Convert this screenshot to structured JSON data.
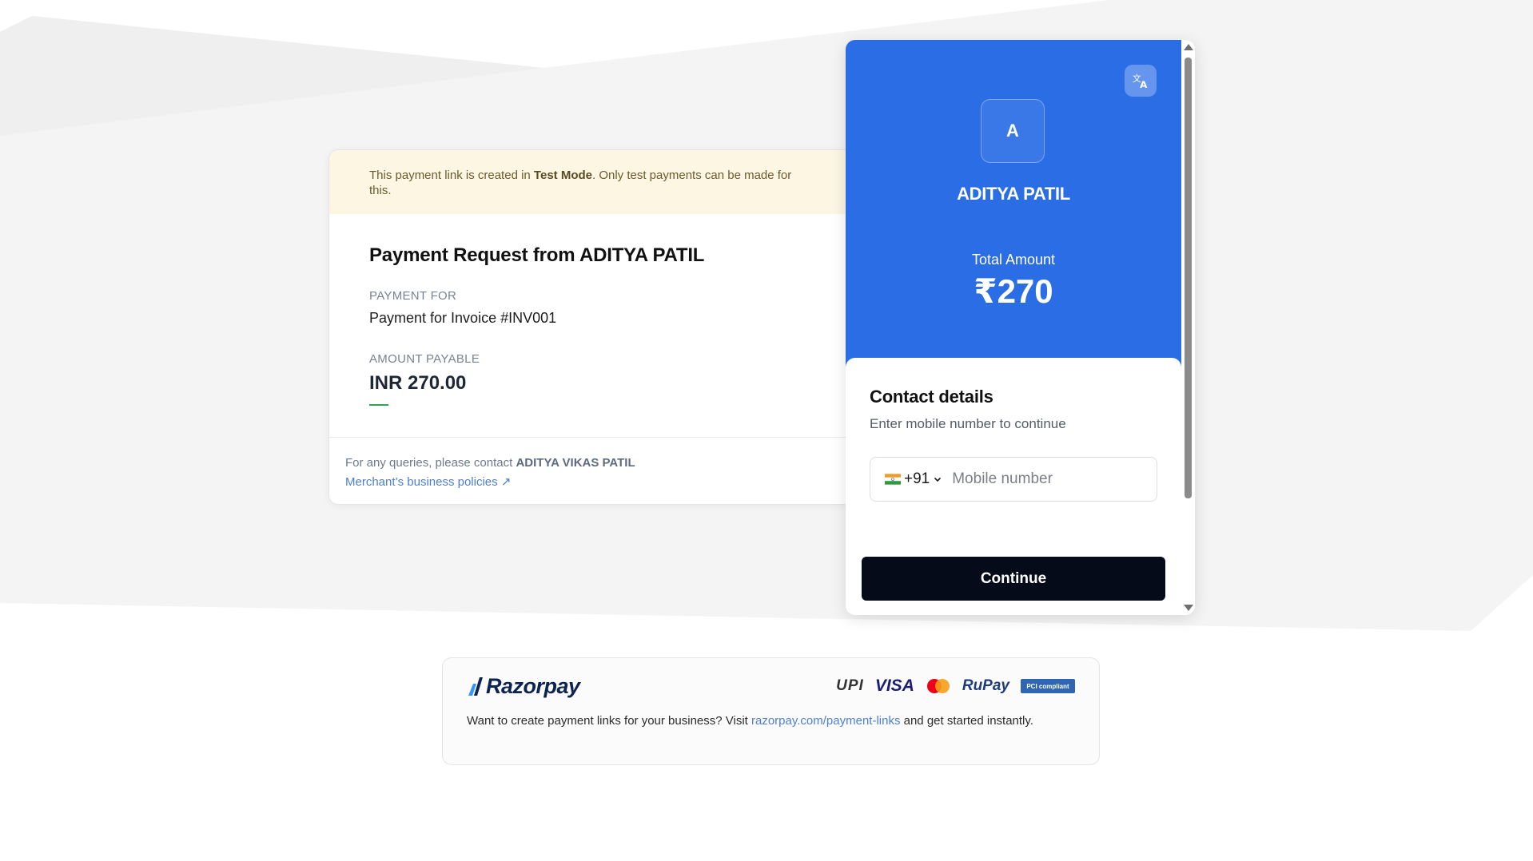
{
  "merchant_card": {
    "banner_prefix": "This payment link is created in ",
    "banner_mode": "Test Mode",
    "banner_suffix": ". Only test payments can be made for this.",
    "title": "Payment Request from ADITYA PATIL",
    "payment_for_label": "PAYMENT FOR",
    "payment_for_value": "Payment for Invoice #INV001",
    "amount_label": "AMOUNT PAYABLE",
    "amount_value": "INR 270.00",
    "queries_prefix": "For any queries, please contact ",
    "queries_contact": "ADITYA VIKAS PATIL",
    "policies_link": "Merchant’s business policies ↗"
  },
  "checkout": {
    "avatar_letter": "A",
    "merchant_name": "ADITYA PATIL",
    "total_label": "Total Amount",
    "total_value": "₹270",
    "contact_title": "Contact details",
    "contact_subtitle": "Enter mobile number to continue",
    "country_code": "+91",
    "phone_placeholder": "Mobile number",
    "continue_label": "Continue",
    "accent_color": "#2a6de5",
    "button_color": "#050b18"
  },
  "footer": {
    "brand": "Razorpay",
    "logos": [
      "UPI",
      "VISA",
      "mastercard",
      "RuPay",
      "PCI compliant"
    ],
    "text_prefix": "Want to create payment links for your business? Visit ",
    "link_text": "razorpay.com/payment-links",
    "text_suffix": " and get started instantly."
  },
  "icons": [
    "translate-icon",
    "india-flag-icon",
    "chevron-down-icon",
    "razorpay-logo-icon"
  ]
}
